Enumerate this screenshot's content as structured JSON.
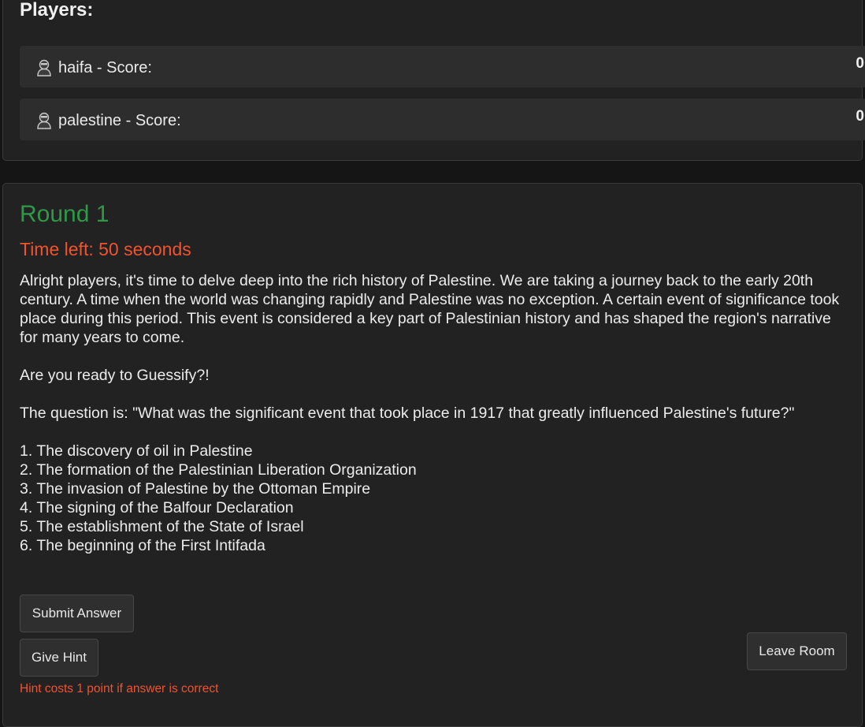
{
  "players": {
    "title": "Players:",
    "list": [
      {
        "label": "haifa - Score:",
        "score": "0"
      },
      {
        "label": "palestine - Score:",
        "score": "0"
      }
    ]
  },
  "round": {
    "title": "Round 1",
    "time_left": "Time left: 50 seconds",
    "text": "Alright players, it's time to delve deep into the rich history of Palestine. We are taking a journey back to the early 20th century. A time when the world was changing rapidly and Palestine was no exception. A certain event of significance took place during this period. This event is considered a key part of Palestinian history and has shaped the region's narrative for many years to come.\n\nAre you ready to Guessify?!\n\nThe question is: \"What was the significant event that took place in 1917 that greatly influenced Palestine's future?\"\n\n1. The discovery of oil in Palestine\n2. The formation of the Palestinian Liberation Organization\n3. The invasion of Palestine by the Ottoman Empire\n4. The signing of the Balfour Declaration\n5. The establishment of the State of Israel\n6. The beginning of the First Intifada"
  },
  "buttons": {
    "submit": "Submit Answer",
    "hint": "Give Hint",
    "leave": "Leave Room"
  },
  "hint_note": "Hint costs 1 point if answer is correct",
  "colors": {
    "round_title": "#2e9a48",
    "timer": "#f0532d",
    "panel": "#222222",
    "row": "#2d2d2d"
  },
  "icons": {
    "player": "user-avatar-icon"
  }
}
